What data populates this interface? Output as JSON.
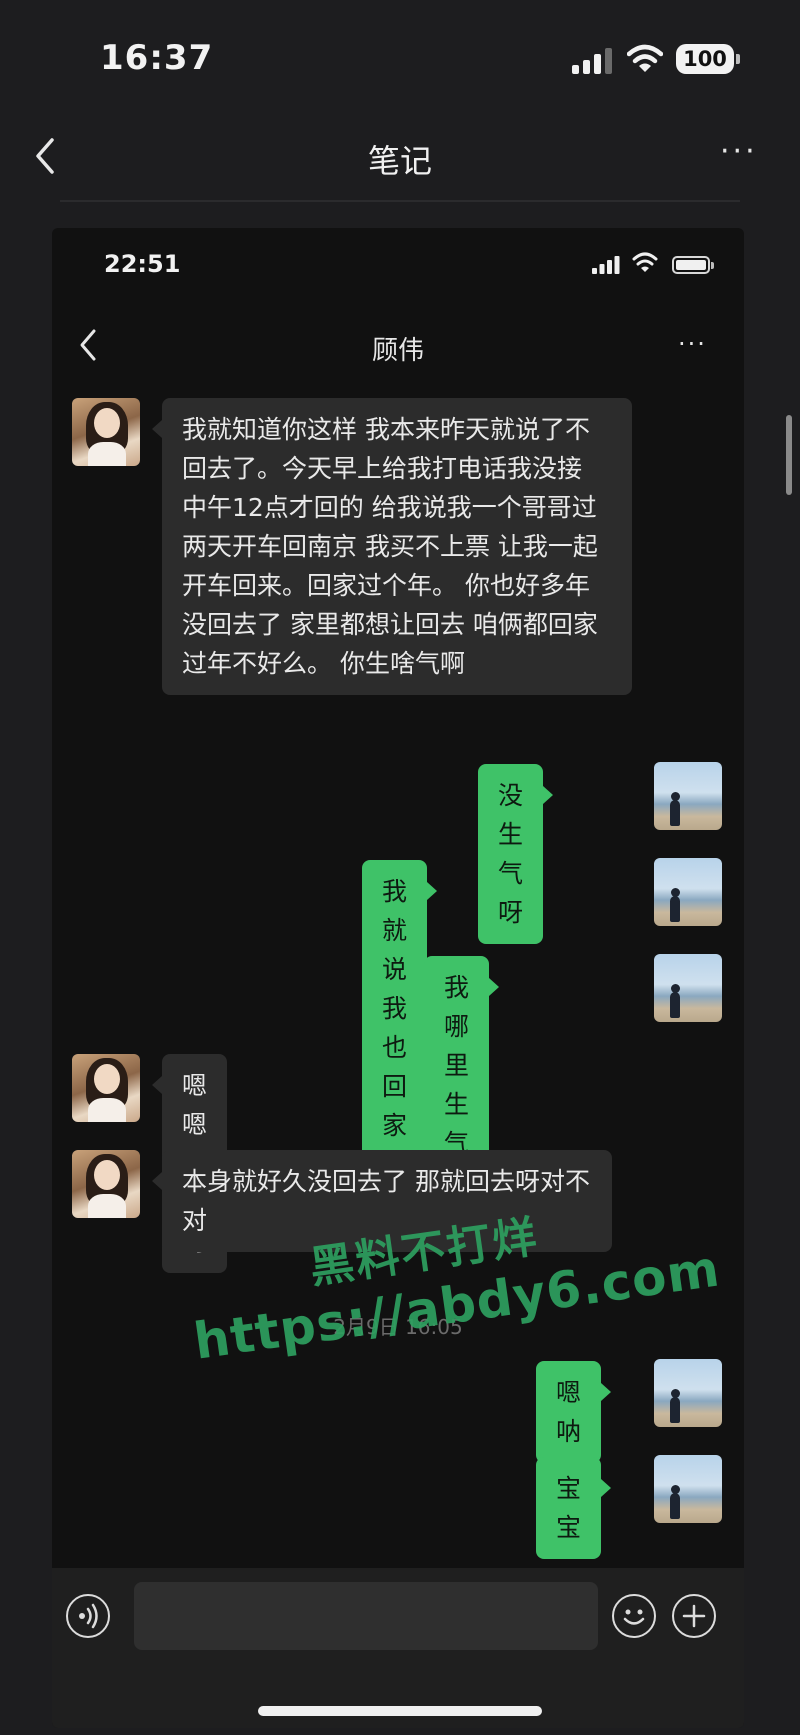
{
  "outer": {
    "time": "16:37",
    "battery": "100",
    "title": "笔记",
    "more": "···"
  },
  "screenshot": {
    "time": "22:51",
    "contact_name": "顾伟",
    "more": "···",
    "messages": [
      {
        "side": "left",
        "text": "我就知道你这样 我本来昨天就说了不回去了。今天早上给我打电话我没接 中午12点才回的 给我说我一个哥哥过两天开车回南京 我买不上票 让我一起开车回来。回家过个年。 你也好多年没回去了 家里都想让回去 咱俩都回家过年不好么。 你生啥气啊"
      },
      {
        "side": "right",
        "text": "没生气呀"
      },
      {
        "side": "right",
        "text": "我就说我也回家了"
      },
      {
        "side": "right",
        "text": "我哪里生气了"
      },
      {
        "side": "left",
        "text": "嗯嗯嗯好呀"
      },
      {
        "side": "left",
        "text": "本身就好久没回去了 那就回去呀对不对"
      },
      {
        "side": "right",
        "text": "嗯呐"
      },
      {
        "side": "right",
        "text": "宝宝"
      }
    ],
    "timestamp": "2月9日 16:05"
  },
  "watermark": {
    "line1": "黑料不打烊",
    "line2": "https://abdy6.com"
  },
  "icons": {
    "back": "chevron-left-icon",
    "more": "more-dots-icon",
    "voice": "voice-icon",
    "emoji": "emoji-icon",
    "plus": "plus-icon"
  },
  "colors": {
    "bubble_right": "#3fc268",
    "bubble_left": "#2c2c2c",
    "background": "#111111",
    "watermark": "#2ea05f"
  }
}
